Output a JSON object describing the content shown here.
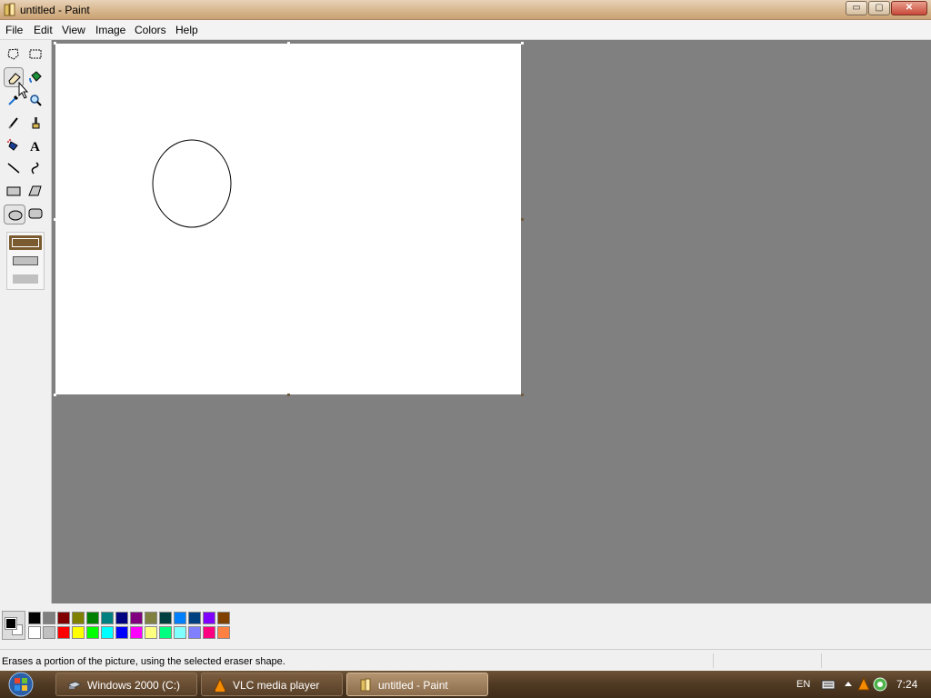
{
  "window": {
    "title": "untitled - Paint",
    "min_glyph": "▭",
    "max_glyph": "▢",
    "close_glyph": "✕"
  },
  "menu": {
    "items": [
      "File",
      "Edit",
      "View",
      "Image",
      "Colors",
      "Help"
    ]
  },
  "toolbox": {
    "tools": [
      {
        "name": "free-form-select-icon"
      },
      {
        "name": "select-icon"
      },
      {
        "name": "eraser-icon",
        "selected": false,
        "hover": true
      },
      {
        "name": "fill-icon"
      },
      {
        "name": "pick-color-icon"
      },
      {
        "name": "magnifier-icon"
      },
      {
        "name": "pencil-icon"
      },
      {
        "name": "brush-icon"
      },
      {
        "name": "airbrush-icon"
      },
      {
        "name": "text-icon",
        "glyph": "A"
      },
      {
        "name": "line-icon"
      },
      {
        "name": "curve-icon"
      },
      {
        "name": "rectangle-icon"
      },
      {
        "name": "polygon-icon"
      },
      {
        "name": "ellipse-icon",
        "selected": true
      },
      {
        "name": "rounded-rectangle-icon"
      }
    ],
    "fill_styles": [
      "outline",
      "outline-fill",
      "fill"
    ]
  },
  "canvas": {
    "background": "#ffffff",
    "shapes": [
      {
        "type": "ellipse",
        "stroke": "#000000"
      }
    ]
  },
  "palette": {
    "foreground": "#000000",
    "background": "#ffffff",
    "row1": [
      "#000000",
      "#808080",
      "#800000",
      "#808000",
      "#008000",
      "#008080",
      "#000080",
      "#800080",
      "#808040",
      "#004040",
      "#0080ff",
      "#004080",
      "#8000ff",
      "#804000"
    ],
    "row2": [
      "#ffffff",
      "#c0c0c0",
      "#ff0000",
      "#ffff00",
      "#00ff00",
      "#00ffff",
      "#0000ff",
      "#ff00ff",
      "#ffff80",
      "#00ff80",
      "#80ffff",
      "#8080ff",
      "#ff0080",
      "#ff8040"
    ]
  },
  "status": {
    "text": "Erases a portion of the picture, using the selected eraser shape."
  },
  "taskbar": {
    "items": [
      {
        "label": "Windows 2000 (C:)",
        "icon": "drive-icon",
        "active": false
      },
      {
        "label": "VLC media player",
        "icon": "vlc-icon",
        "active": false
      },
      {
        "label": "untitled - Paint",
        "icon": "paint-icon",
        "active": true
      }
    ],
    "language": "EN",
    "clock": "7:24"
  },
  "colors": {
    "accent": "#c9a173",
    "workspace": "#808080"
  }
}
